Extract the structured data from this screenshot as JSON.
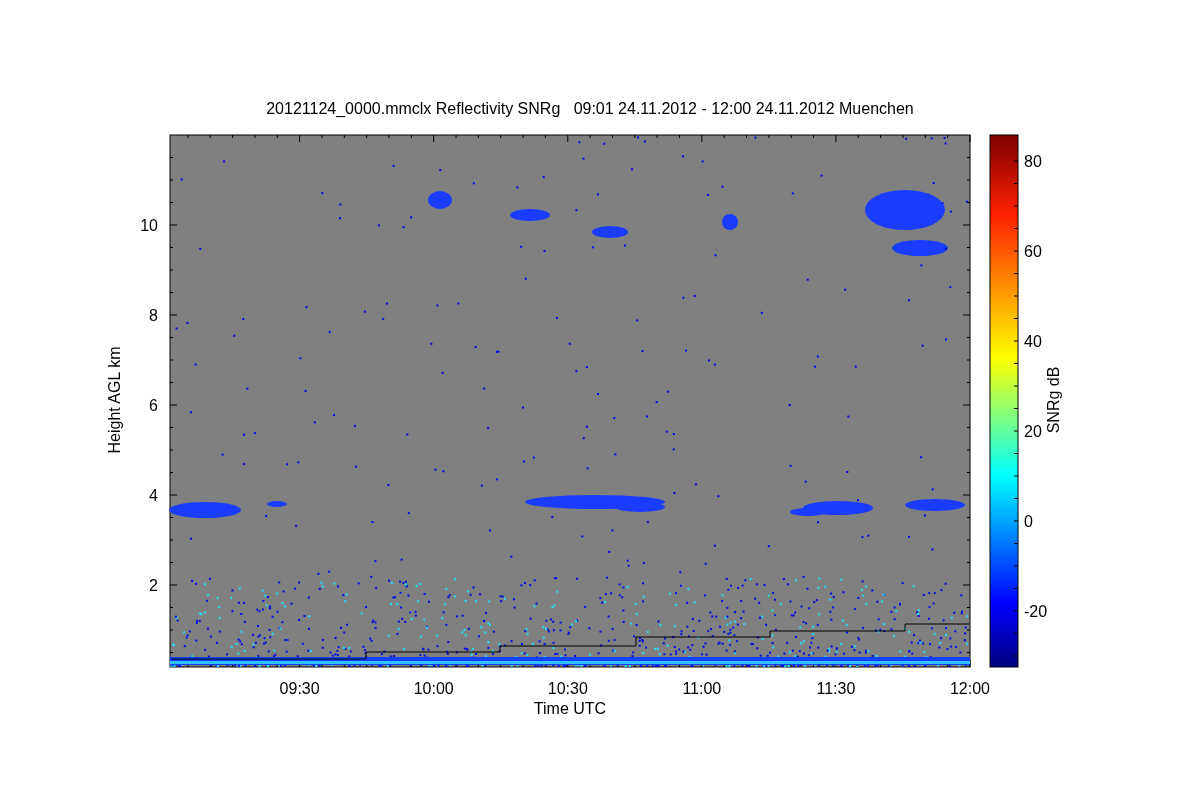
{
  "title": "20121124_0000.mmclx Reflectivity SNRg   09:01 24.11.2012 - 12:00 24.11.2012 Muenchen",
  "ylabel": "Height AGL km",
  "yticks": [
    "10",
    "8",
    "6",
    "4",
    "2"
  ],
  "xticks": [
    "09:30",
    "10:00",
    "10:30",
    "11:00",
    "11:30",
    "12:00"
  ],
  "xlabel": "Time UTC",
  "colorbar": {
    "label": "SNRg dB",
    "ticks": [
      "80",
      "60",
      "40",
      "20",
      "0",
      "-20"
    ]
  }
}
